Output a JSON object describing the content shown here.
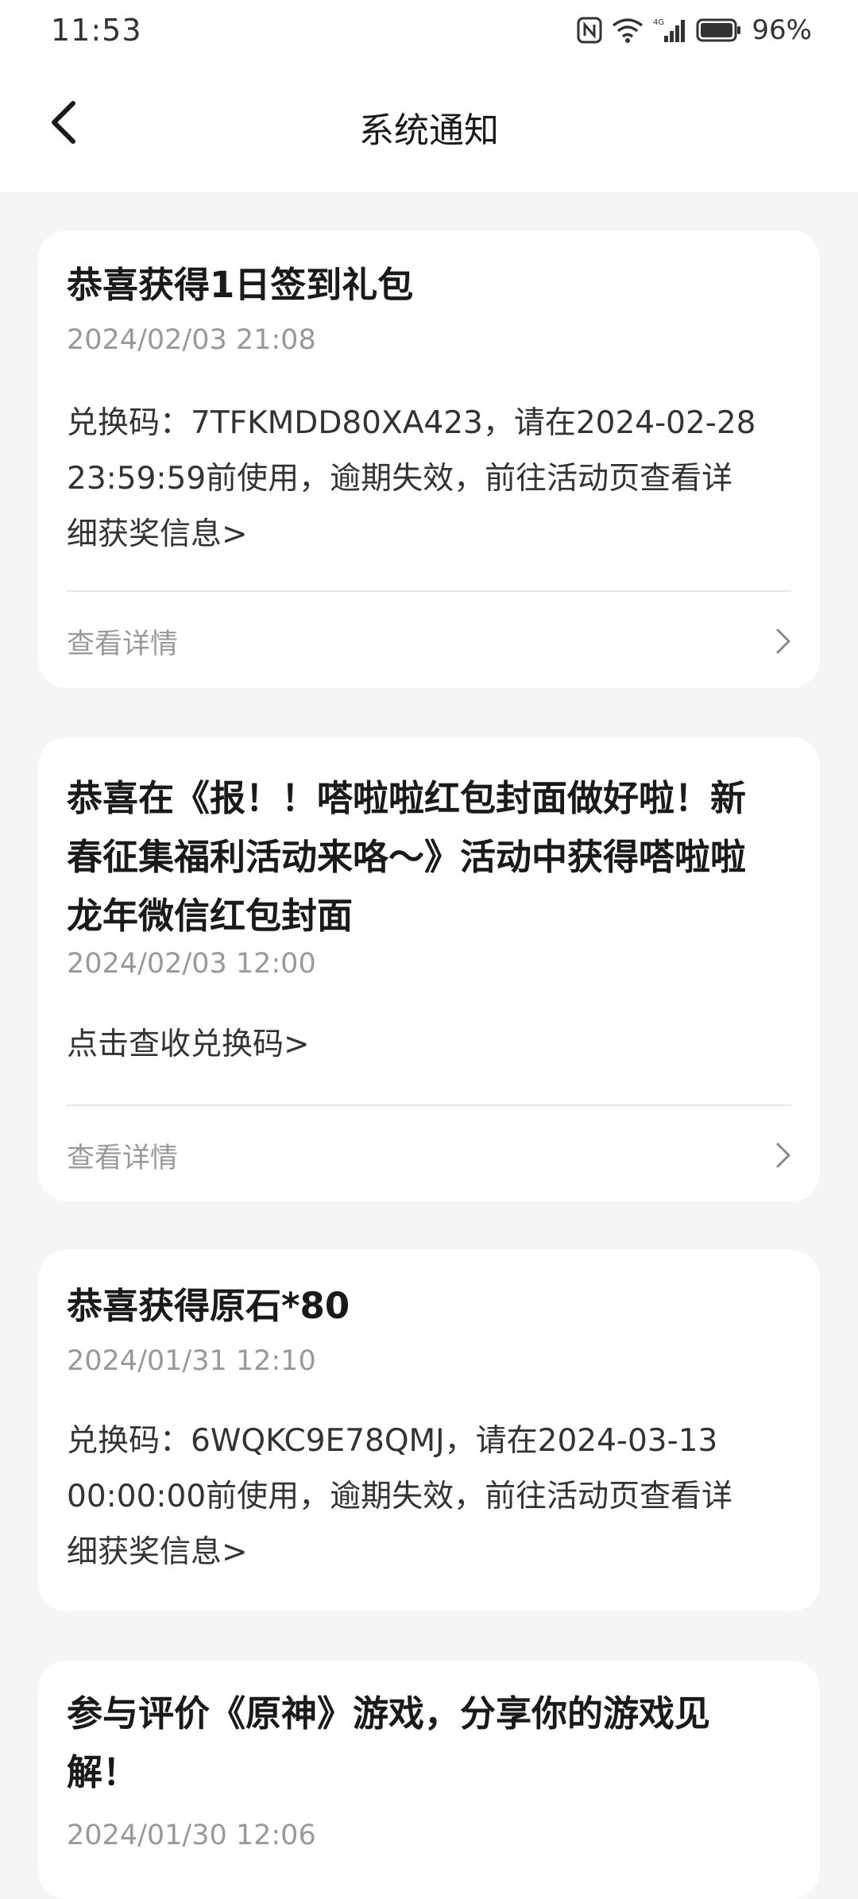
{
  "status_bar": {
    "time": "11:53",
    "battery": "96%"
  },
  "header": {
    "title": "系统通知"
  },
  "notifications": [
    {
      "title": "恭喜获得1日签到礼包",
      "date": "2024/02/03 21:08",
      "body_lines": [
        "兑换码：7TFKMDD80XA423，请在2024-02-28",
        "23:59:59前使用，逾期失效，前往活动页查看详",
        "细获奖信息>"
      ],
      "detail_label": "查看详情"
    },
    {
      "title_lines": [
        "恭喜在《报！！嗒啦啦红包封面做好啦！新",
        "春征集福利活动来咯～》活动中获得嗒啦啦",
        "龙年微信红包封面"
      ],
      "date": "2024/02/03 12:00",
      "body_lines": [
        "点击查收兑换码>"
      ],
      "detail_label": "查看详情"
    },
    {
      "title": "恭喜获得原石*80",
      "date": "2024/01/31 12:10",
      "body_lines": [
        "兑换码：6WQKC9E78QMJ，请在2024-03-13",
        "00:00:00前使用，逾期失效，前往活动页查看详",
        "细获奖信息>"
      ]
    },
    {
      "title_lines": [
        "参与评价《原神》游戏，分享你的游戏见",
        "解！"
      ],
      "date": "2024/01/30 12:06"
    }
  ]
}
